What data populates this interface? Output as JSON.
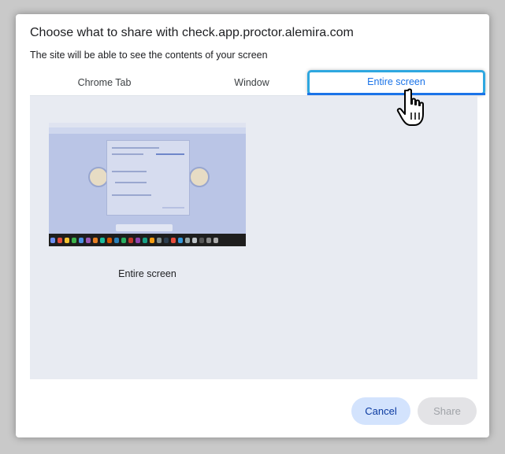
{
  "dialog": {
    "title": "Choose what to share with check.app.proctor.alemira.com",
    "subtitle": "The site will be able to see the contents of your screen"
  },
  "tabs": [
    {
      "label": "Chrome Tab",
      "selected": false
    },
    {
      "label": "Window",
      "selected": false
    },
    {
      "label": "Entire screen",
      "selected": true
    }
  ],
  "panel": {
    "source_label": "Entire screen"
  },
  "buttons": {
    "cancel_label": "Cancel",
    "share_label": "Share",
    "share_enabled": false
  },
  "colors": {
    "accent": "#1a73e8",
    "highlight": "#2ea7e0",
    "panel_bg": "#e8ebf2",
    "cancel_bg": "#d3e3fd",
    "share_disabled_bg": "#e3e3e6"
  },
  "icons": [
    "hand-pointer-cursor-icon"
  ]
}
